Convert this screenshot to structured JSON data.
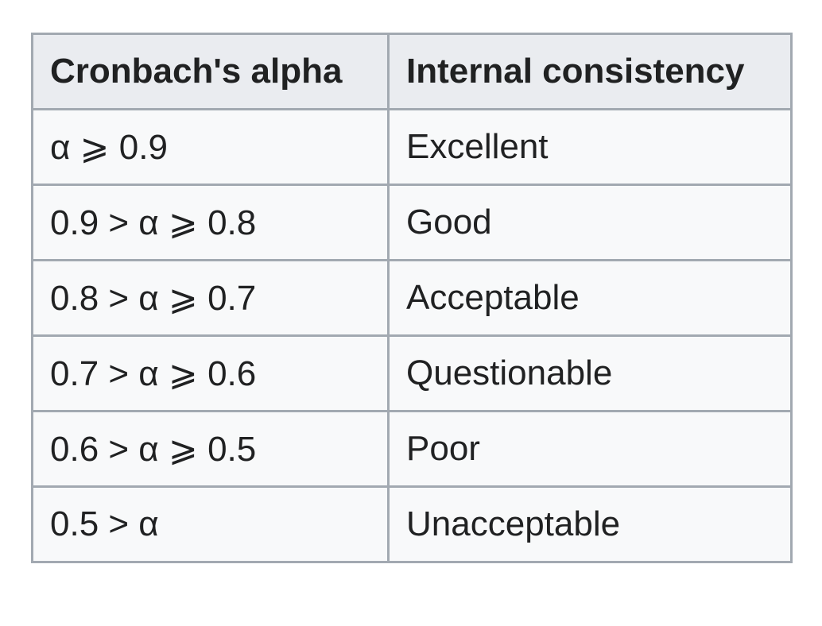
{
  "table": {
    "headers": [
      "Cronbach's alpha",
      "Internal consistency"
    ],
    "rows": [
      [
        "α ⩾ 0.9",
        "Excellent"
      ],
      [
        "0.9 > α ⩾ 0.8",
        "Good"
      ],
      [
        "0.8 > α ⩾ 0.7",
        "Acceptable"
      ],
      [
        "0.7 > α ⩾ 0.6",
        "Questionable"
      ],
      [
        "0.6 > α ⩾ 0.5",
        "Poor"
      ],
      [
        "0.5 > α",
        "Unacceptable"
      ]
    ]
  },
  "colors": {
    "border": "#a2a9b1",
    "header_bg": "#eaecf0",
    "cell_bg": "#f8f9fa",
    "text": "#202122"
  }
}
